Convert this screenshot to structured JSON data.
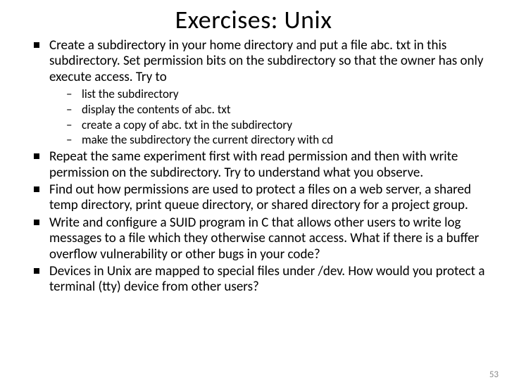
{
  "title": "Exercises: Unix",
  "bullets": [
    {
      "text": "Create a subdirectory in your home directory and put a file abc. txt in this subdirectory. Set permission bits on the subdirectory so that the owner has only execute access. Try to",
      "sub": [
        "list the subdirectory",
        "display the contents of abc. txt",
        "create a copy of abc. txt in the subdirectory",
        "make the subdirectory the current directory with cd"
      ]
    },
    {
      "text": "Repeat the same experiment first with read permission and then with write permission on the subdirectory. Try to understand what you observe."
    },
    {
      "text": "Find out how permissions are used to protect a files on a web server, a shared temp directory, print queue directory, or shared directory for a project group."
    },
    {
      "text": "Write and configure a SUID program in C that allows other users to write log messages to a file which they otherwise cannot access. What if there is a buffer overflow vulnerability or other bugs in your code?"
    },
    {
      "text": "Devices in Unix are mapped to special files under /dev. How would you protect a terminal (tty) device from other users?"
    }
  ],
  "page_number": "53"
}
